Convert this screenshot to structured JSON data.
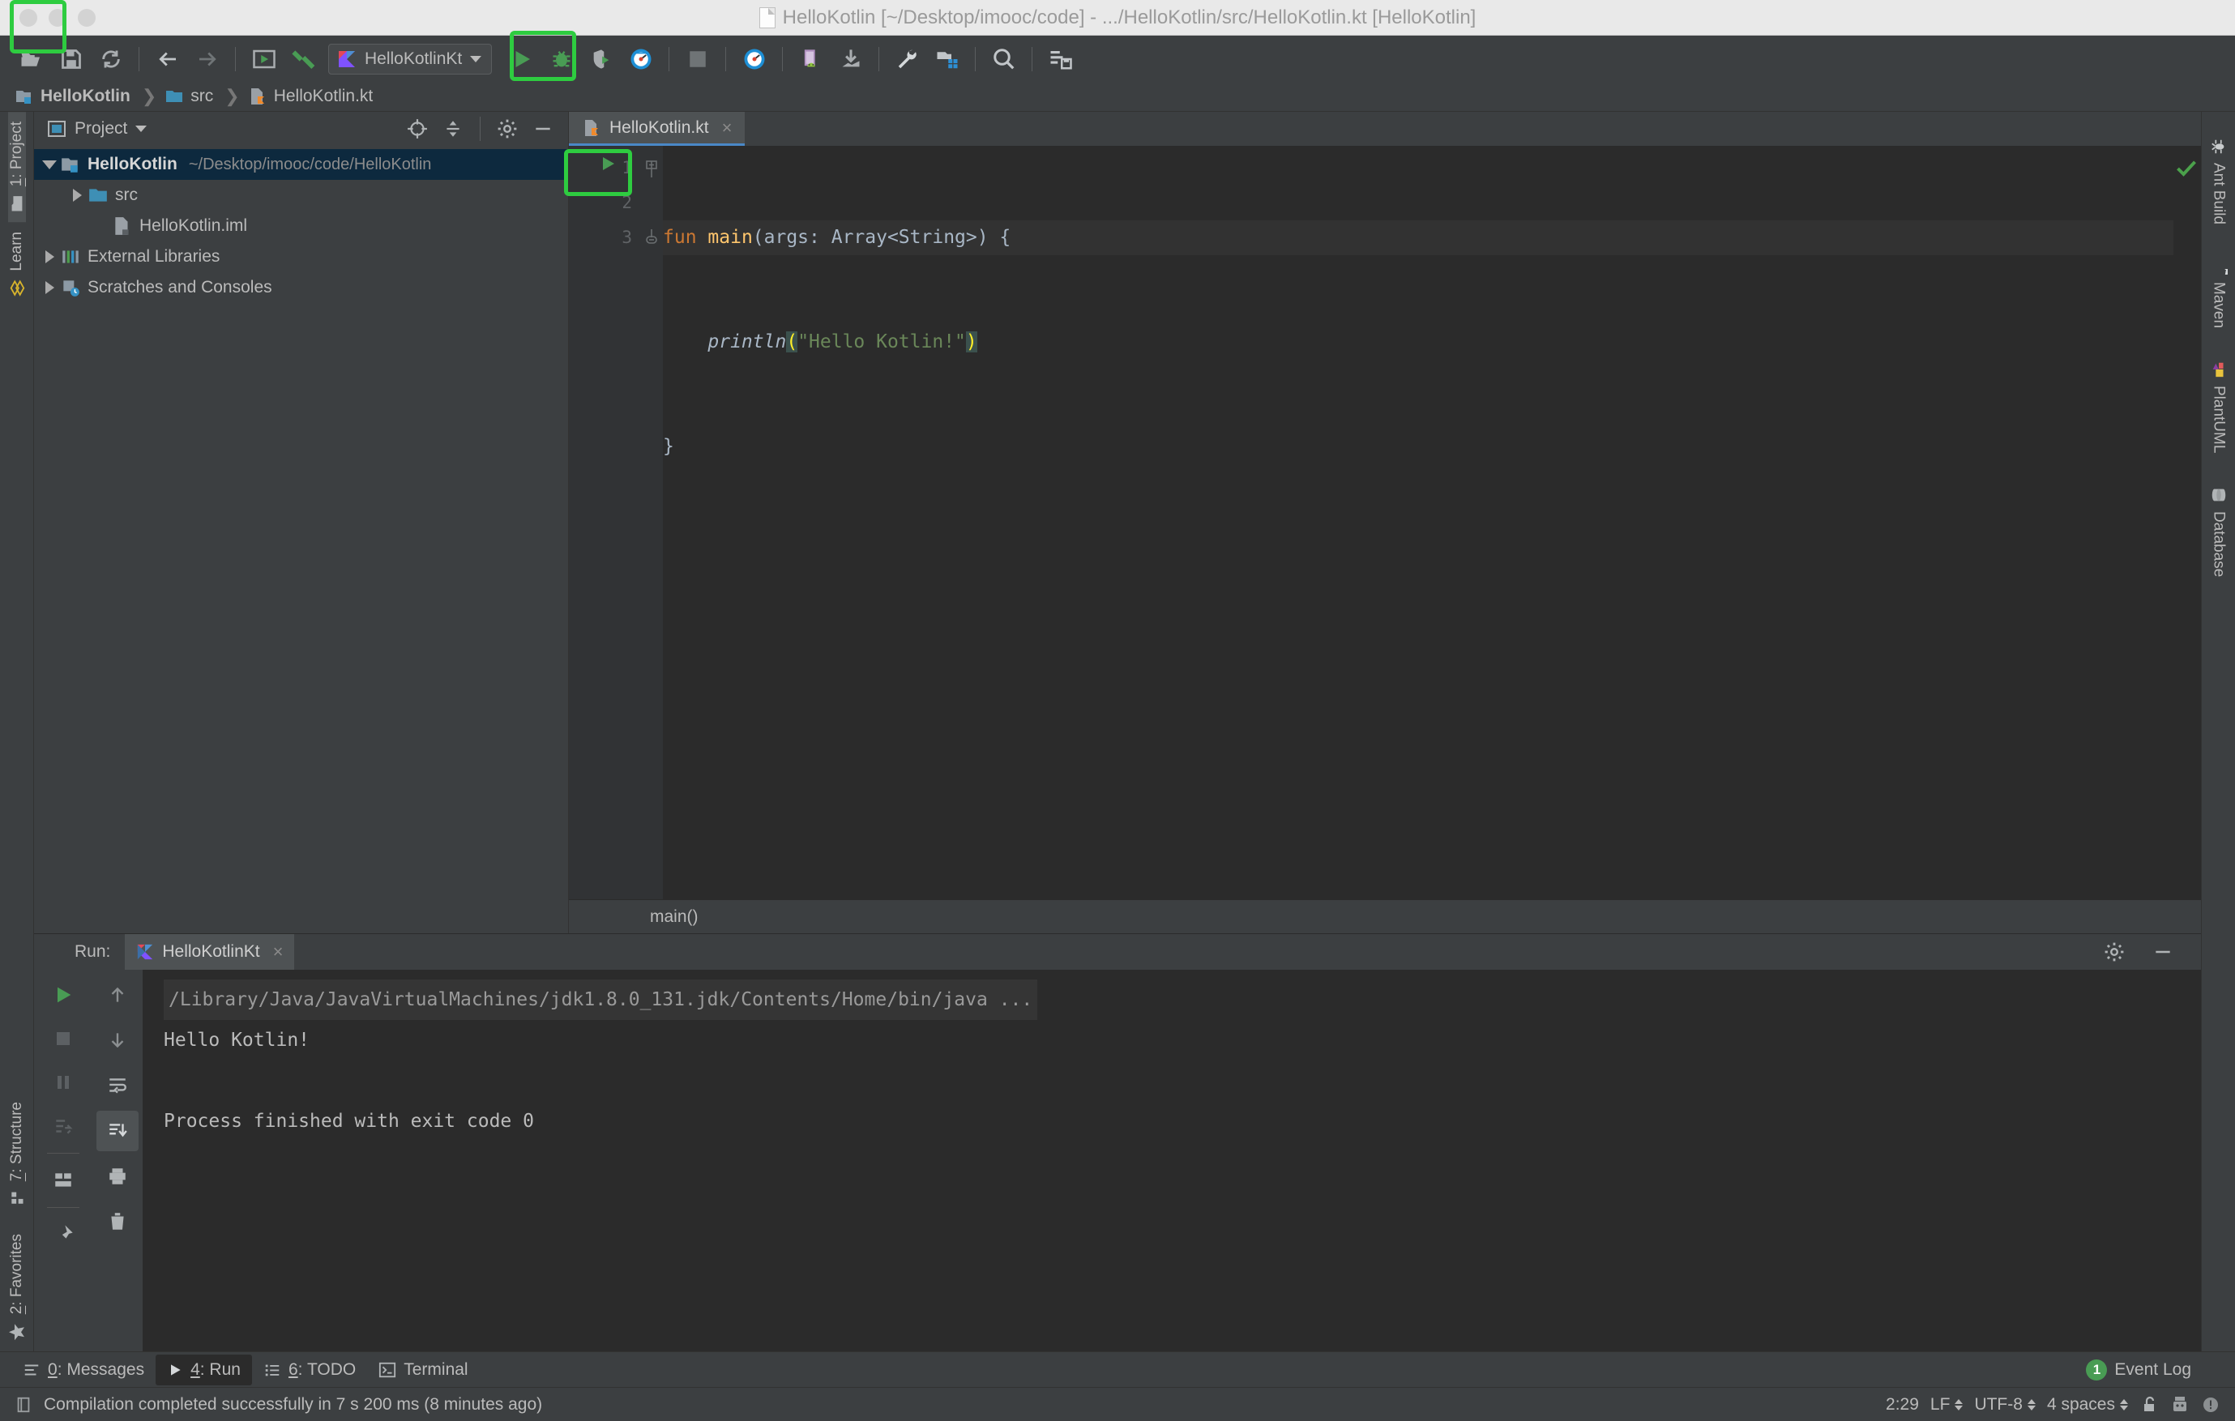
{
  "window": {
    "title": "HelloKotlin [~/Desktop/imooc/code] - .../HelloKotlin/src/HelloKotlin.kt [HelloKotlin]"
  },
  "toolbar": {
    "icons": [
      "open-folder-icon",
      "save-icon",
      "sync-icon",
      "back-arrow-icon",
      "forward-arrow-icon",
      "run-window-icon",
      "build-hammer-icon"
    ],
    "run_config": "HelloKotlinKt",
    "right_icons": [
      "run-icon",
      "debug-icon",
      "coverage-icon",
      "profiler-icon",
      "stop-icon",
      "profiler-gauge-icon",
      "android-device-icon",
      "download-icon",
      "wrench-icon",
      "sdk-manager-icon",
      "search-icon",
      "sync-db-icon"
    ],
    "accent_green": "#2ecc40"
  },
  "breadcrumb": {
    "items": [
      {
        "label": "HelloKotlin",
        "icon": "module-icon"
      },
      {
        "label": "src",
        "icon": "folder-icon"
      },
      {
        "label": "HelloKotlin.kt",
        "icon": "kotlin-file-icon"
      }
    ]
  },
  "left_strip": {
    "tabs": [
      {
        "num": "1",
        "label": ": Project",
        "icon": "folder-icon",
        "active": true
      },
      {
        "num": "",
        "label": "Learn",
        "icon": "learn-icon",
        "active": false
      }
    ],
    "bottom_tabs": [
      {
        "num": "7",
        "label": ": Structure",
        "icon": "structure-icon"
      },
      {
        "num": "2",
        "label": ": Favorites",
        "icon": "star-icon"
      }
    ]
  },
  "right_strip": {
    "tabs": [
      {
        "label": "Ant Build",
        "icon": "ant-icon"
      },
      {
        "label": "Maven",
        "icon": "maven-icon"
      },
      {
        "label": "PlantUML",
        "icon": "plantuml-icon"
      },
      {
        "label": "Database",
        "icon": "database-icon"
      }
    ]
  },
  "project_panel": {
    "title": "Project",
    "header_icons": [
      "locate-icon",
      "collapse-all-icon",
      "settings-gear-icon",
      "minimize-icon"
    ],
    "tree": [
      {
        "label": "HelloKotlin",
        "path": "~/Desktop/imooc/code/HelloKotlin",
        "indent": 0,
        "arrow": "open",
        "icon": "module-icon",
        "bold": true,
        "selected": true
      },
      {
        "label": "src",
        "path": "",
        "indent": 1,
        "arrow": "closed",
        "icon": "folder-icon",
        "bold": false,
        "selected": false
      },
      {
        "label": "HelloKotlin.iml",
        "path": "",
        "indent": 2,
        "arrow": "none",
        "icon": "iml-icon",
        "bold": false,
        "selected": false
      },
      {
        "label": "External Libraries",
        "path": "",
        "indent": 0,
        "arrow": "closed",
        "icon": "libraries-icon",
        "bold": false,
        "selected": false
      },
      {
        "label": "Scratches and Consoles",
        "path": "",
        "indent": 0,
        "arrow": "closed",
        "icon": "scratches-icon",
        "bold": false,
        "selected": false
      }
    ]
  },
  "editor": {
    "tab_label": "HelloKotlin.kt",
    "tab_close": "×",
    "line_numbers": [
      "1",
      "2",
      "3"
    ],
    "code": {
      "line1_kw": "fun",
      "line1_name": "main",
      "line1_sig": "(args: Array<String>) {",
      "line2_fn": "println",
      "line2_open": "(",
      "line2_str": "\"Hello Kotlin!\"",
      "line2_close": ")",
      "line3": "}"
    },
    "footer_breadcrumb": "main()",
    "inspection_status": "ok-check"
  },
  "run_panel": {
    "label": "Run:",
    "tab_label": "HelloKotlinKt",
    "tab_close": "×",
    "header_icons": [
      "settings-gear-icon",
      "minimize-icon"
    ],
    "left_tools": [
      "rerun-icon",
      "stop-icon",
      "pause-icon",
      "rerun-failed-icon",
      "layout-icon",
      "pin-icon"
    ],
    "right_tools": [
      "up-arrow-icon",
      "down-arrow-icon",
      "soft-wrap-icon",
      "scroll-to-end-icon",
      "print-icon",
      "trash-icon"
    ],
    "console": {
      "command": "/Library/Java/JavaVirtualMachines/jdk1.8.0_131.jdk/Contents/Home/bin/java ...",
      "output": "Hello Kotlin!",
      "exit": "Process finished with exit code 0"
    }
  },
  "bottom_bar": {
    "tabs": [
      {
        "num": "0",
        "label": ": Messages",
        "icon": "messages-icon",
        "active": false
      },
      {
        "num": "4",
        "label": ": Run",
        "icon": "run-triangle-icon",
        "active": true
      },
      {
        "num": "6",
        "label": ": TODO",
        "icon": "todo-icon",
        "active": false
      },
      {
        "num": "",
        "label": "Terminal",
        "icon": "terminal-icon",
        "active": false
      }
    ],
    "event_log": "Event Log",
    "event_count": "1"
  },
  "status_bar": {
    "message": "Compilation completed successfully in 7 s 200 ms (8 minutes ago)",
    "caret": "2:29",
    "line_sep": "LF",
    "encoding": "UTF-8",
    "indent": "4 spaces",
    "icons": [
      "lock-open-icon",
      "inspector-icon",
      "warning-icon"
    ]
  }
}
